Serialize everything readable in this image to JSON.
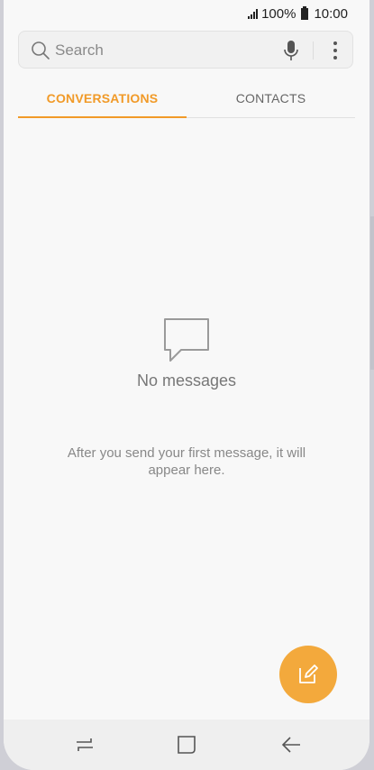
{
  "status_bar": {
    "battery": "100%",
    "time": "10:00",
    "icons": [
      "signal-icon",
      "battery-icon"
    ]
  },
  "search": {
    "placeholder": "Search",
    "icons": [
      "search-icon",
      "mic-icon",
      "more-options-icon"
    ]
  },
  "tabs": [
    {
      "label": "CONVERSATIONS",
      "selected": true
    },
    {
      "label": "CONTACTS",
      "selected": false
    }
  ],
  "empty_state": {
    "icon": "message-bubble-icon",
    "title": "No messages",
    "description": "After you send your first message, it will appear here."
  },
  "fab": {
    "icon": "compose-icon"
  },
  "nav_bar": {
    "icons": [
      "recent-apps-icon",
      "home-icon",
      "back-icon"
    ]
  },
  "colors": {
    "accent": "#f19a28",
    "fab": "#f3a93c",
    "background": "#f8f8f8"
  }
}
